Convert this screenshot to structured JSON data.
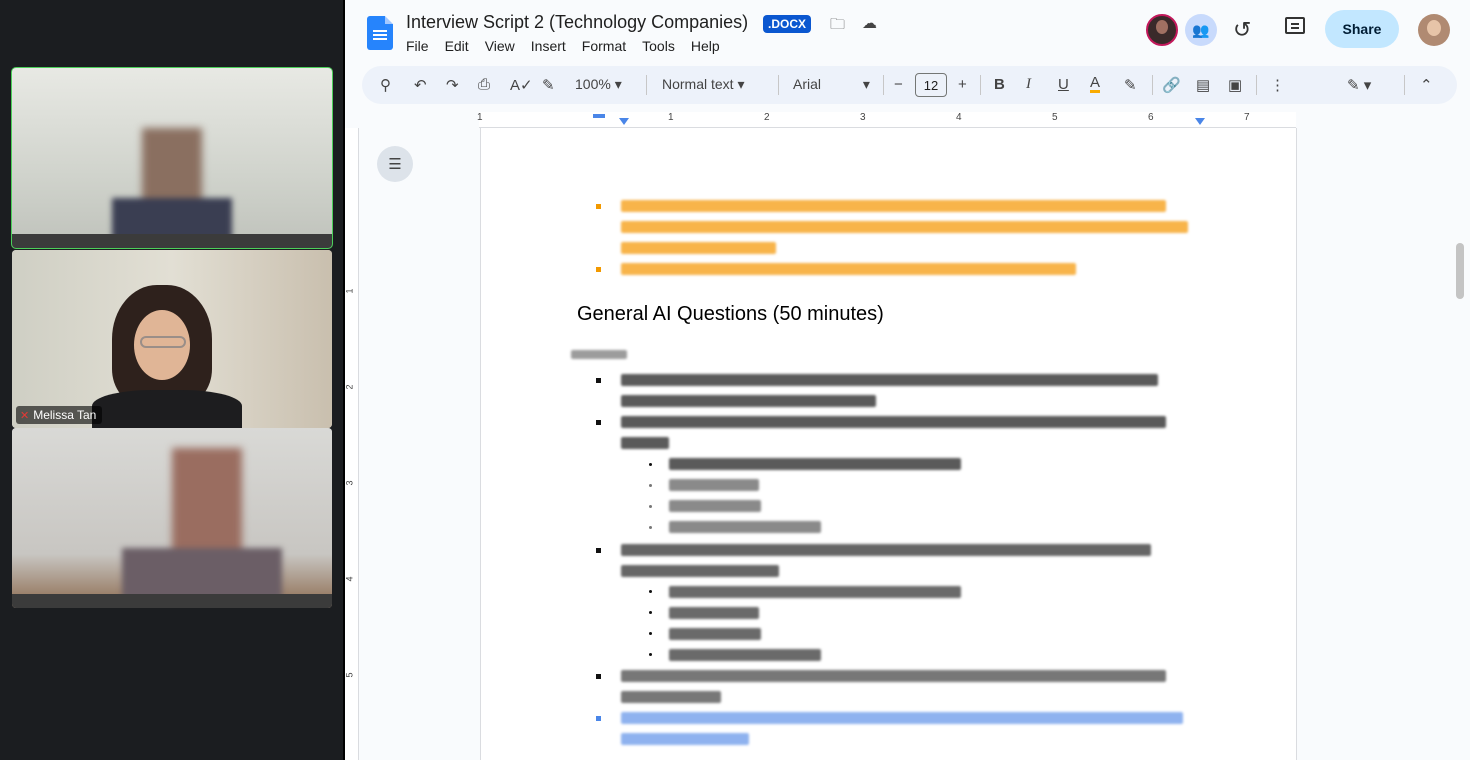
{
  "video_call": {
    "participants": [
      {
        "name": "",
        "active": true
      },
      {
        "name": "Melissa Tan",
        "active": false
      },
      {
        "name": "",
        "active": false
      }
    ]
  },
  "document": {
    "title": "Interview Script 2 (Technology Companies)",
    "format_badge": ".DOCX",
    "menu": [
      "File",
      "Edit",
      "View",
      "Insert",
      "Format",
      "Tools",
      "Help"
    ],
    "share_label": "Share",
    "heading": "General AI Questions (50 minutes)"
  },
  "toolbar": {
    "zoom": "100%",
    "style": "Normal text",
    "font": "Arial",
    "font_size": "12",
    "minus": "−",
    "plus": "+"
  },
  "ruler": {
    "labels": [
      "1",
      "1",
      "2",
      "3",
      "4",
      "5",
      "6",
      "7"
    ],
    "vertical_labels": [
      "1",
      "2",
      "3",
      "4",
      "5"
    ]
  },
  "colors": {
    "accent": "#0b57d0",
    "orange_text": "#f29900",
    "blue_text": "#4a86e8",
    "active_border": "#4ccf5a"
  },
  "icons": {
    "search": "search-icon",
    "undo": "undo-icon",
    "redo": "redo-icon",
    "print": "print-icon",
    "spellcheck": "spellcheck-icon",
    "paint_format": "paint-format-icon",
    "bold": "B",
    "italic": "I",
    "underline": "U",
    "text_color": "A"
  }
}
